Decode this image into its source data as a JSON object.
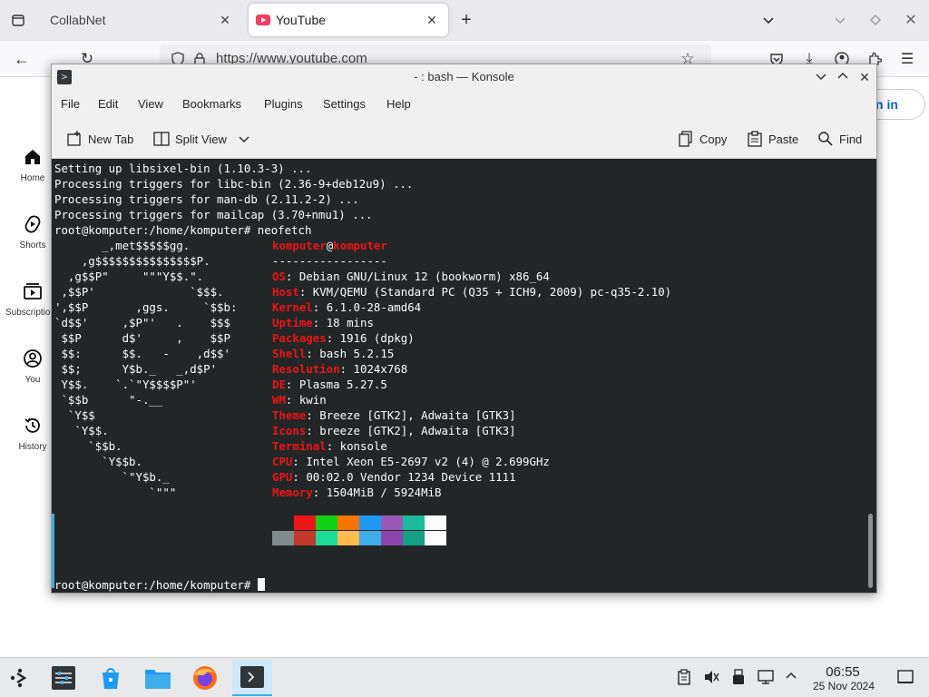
{
  "browser": {
    "tabs": [
      {
        "label": "CollabNet"
      },
      {
        "label": "YouTube"
      }
    ],
    "url": "https://www.youtube.com",
    "sidebar": [
      {
        "label": "Home"
      },
      {
        "label": "Shorts"
      },
      {
        "label": "Subscriptions"
      },
      {
        "label": "You"
      },
      {
        "label": "History"
      }
    ],
    "signin_label": "n in"
  },
  "konsole": {
    "title": "- : bash — Konsole",
    "menu": [
      "File",
      "Edit",
      "View",
      "Bookmarks",
      "Plugins",
      "Settings",
      "Help"
    ],
    "toolbar": {
      "new_tab": "New Tab",
      "split_view": "Split View",
      "copy": "Copy",
      "paste": "Paste",
      "find": "Find"
    },
    "output_lines": [
      "Setting up libsixel-bin (1.10.3-3) ...",
      "Processing triggers for libc-bin (2.36-9+deb12u9) ...",
      "Processing triggers for man-db (2.11.2-2) ...",
      "Processing triggers for mailcap (3.70+nmu1) ...",
      "root@komputer:/home/komputer# neofetch"
    ],
    "logo_lines": [
      "       _,met$$$$$gg.",
      "    ,g$$$$$$$$$$$$$$$P.",
      "  ,g$$P\"     \"\"\"Y$$.\".",
      " ,$$P'              `$$$.",
      "',$$P       ,ggs.     `$$b:",
      "`d$$'     ,$P\"'   .    $$$",
      " $$P      d$'     ,    $$P",
      " $$:      $$.   -    ,d$$'",
      " $$;      Y$b._   _,d$P'",
      " Y$$.    `.`\"Y$$$$P\"'",
      " `$$b      \"-.__",
      "  `Y$$",
      "   `Y$$.",
      "     `$$b.",
      "       `Y$$b.",
      "          `\"Y$b._",
      "              `\"\"\""
    ],
    "neofetch": {
      "user": "komputer",
      "at": "@",
      "host": "komputer",
      "separator": "-----------------",
      "fields": [
        {
          "key": "OS",
          "value": "Debian GNU/Linux 12 (bookworm) x86_64"
        },
        {
          "key": "Host",
          "value": "KVM/QEMU (Standard PC (Q35 + ICH9, 2009) pc-q35-2.10)"
        },
        {
          "key": "Kernel",
          "value": "6.1.0-28-amd64"
        },
        {
          "key": "Uptime",
          "value": "18 mins"
        },
        {
          "key": "Packages",
          "value": "1916 (dpkg)"
        },
        {
          "key": "Shell",
          "value": "bash 5.2.15"
        },
        {
          "key": "Resolution",
          "value": "1024x768"
        },
        {
          "key": "DE",
          "value": "Plasma 5.27.5"
        },
        {
          "key": "WM",
          "value": "kwin"
        },
        {
          "key": "Theme",
          "value": "Breeze [GTK2], Adwaita [GTK3]"
        },
        {
          "key": "Icons",
          "value": "breeze [GTK2], Adwaita [GTK3]"
        },
        {
          "key": "Terminal",
          "value": "konsole"
        },
        {
          "key": "CPU",
          "value": "Intel Xeon E5-2697 v2 (4) @ 2.699GHz"
        },
        {
          "key": "GPU",
          "value": "00:02.0 Vendor 1234 Device 1111"
        },
        {
          "key": "Memory",
          "value": "1504MiB / 5924MiB"
        }
      ],
      "palette_top": [
        "#232627",
        "#ed1515",
        "#11d116",
        "#f67400",
        "#1d99f3",
        "#9b59b6",
        "#1abc9c",
        "#fcfcfc"
      ],
      "palette_bottom": [
        "#7f8c8d",
        "#c0392b",
        "#1cdc9a",
        "#fdbc4b",
        "#3daee9",
        "#8e44ad",
        "#16a085",
        "#ffffff"
      ]
    },
    "prompt": "root@komputer:/home/komputer# "
  },
  "panel": {
    "time": "06:55",
    "date": "25 Nov 2024"
  }
}
